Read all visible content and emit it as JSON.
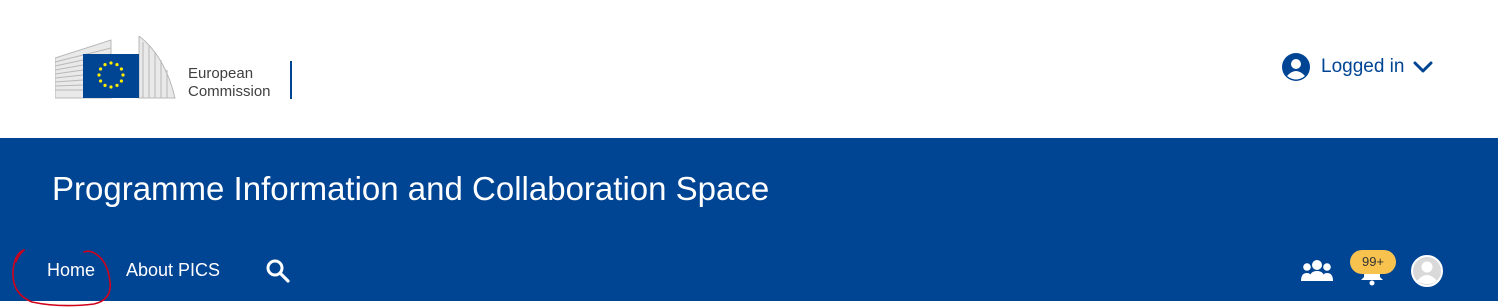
{
  "header": {
    "logo_line1": "European",
    "logo_line2": "Commission",
    "login_label": "Logged in"
  },
  "site": {
    "title": "Programme Information and Collaboration Space"
  },
  "nav": {
    "items": [
      {
        "label": "Home"
      },
      {
        "label": "About PICS"
      }
    ]
  },
  "notifications": {
    "badge": "99+"
  },
  "colors": {
    "brand_blue": "#004494",
    "badge_yellow": "#f7c34e",
    "annotation_red": "#d0021b"
  },
  "icons": [
    "eu-flag-icon",
    "user-circle-icon",
    "chevron-down-icon",
    "search-icon",
    "group-icon",
    "bell-icon",
    "avatar-icon"
  ]
}
